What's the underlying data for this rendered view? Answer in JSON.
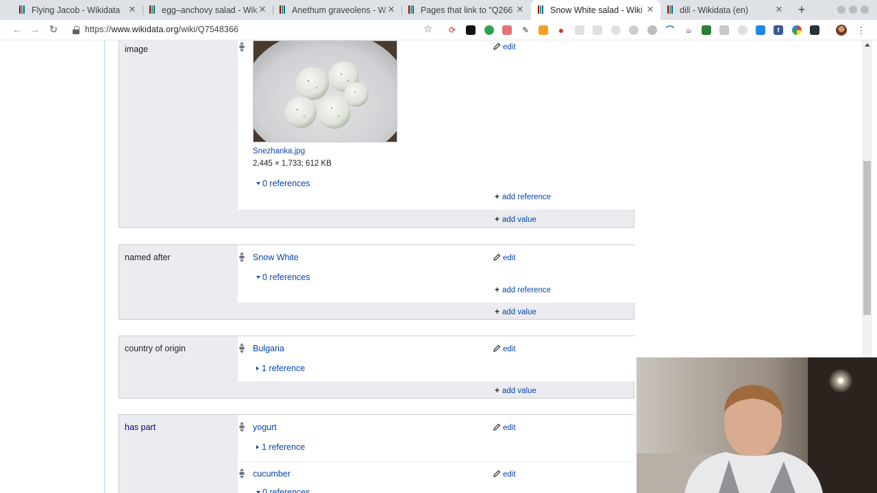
{
  "browser": {
    "tabs": [
      {
        "title": "Flying Jacob - Wikidata",
        "active": false
      },
      {
        "title": "egg–anchovy salad - Wik",
        "active": false
      },
      {
        "title": "Anethum graveolens - W",
        "active": false
      },
      {
        "title": "Pages that link to \"Q266",
        "active": false
      },
      {
        "title": "Snow White salad - Wiki",
        "active": true
      },
      {
        "title": "dill - Wikidata (en)",
        "active": false
      }
    ],
    "url_scheme": "https://",
    "url_host": "www.wikidata.org",
    "url_path": "/wiki/Q7548366",
    "colors": {
      "tabstrip": "#dee1e6",
      "wikidata_red": "#990000",
      "wikidata_green": "#339966",
      "wikidata_blue": "#006699"
    }
  },
  "statements": {
    "image": {
      "property": "image",
      "file_name": "Snezhanka.jpg",
      "file_meta": "2,445 × 1,733; 612 KB",
      "references": "0 references",
      "edit": "edit",
      "add_reference": "add reference",
      "add_value": "add value"
    },
    "named_after": {
      "property": "named after",
      "value": "Snow White",
      "references": "0 references",
      "edit": "edit",
      "add_reference": "add reference",
      "add_value": "add value"
    },
    "country_of_origin": {
      "property": "country of origin",
      "value": "Bulgaria",
      "references": "1 reference",
      "edit": "edit",
      "add_value": "add value"
    },
    "has_part": {
      "property": "has part",
      "values": [
        {
          "value": "yogurt",
          "references": "1 reference",
          "edit": "edit"
        },
        {
          "value": "cucumber",
          "references": "0 references",
          "edit": "edit"
        }
      ]
    }
  },
  "icons": [
    "pencil-icon",
    "rank-selector-icon",
    "lock-icon",
    "star-icon",
    "reload-icon",
    "back-icon",
    "forward-icon"
  ]
}
